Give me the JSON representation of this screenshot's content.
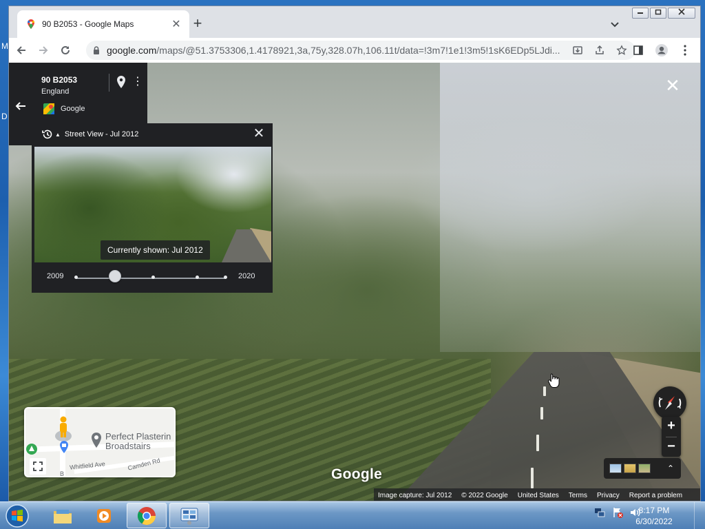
{
  "desktop": {
    "letters": [
      "M",
      "D"
    ]
  },
  "browser": {
    "tab_title": "90 B2053 - Google Maps",
    "tab_close": "✕",
    "new_tab": "+",
    "url_host": "google.com",
    "url_rest": "/maps/@51.3753306,1.4178921,3a,75y,328.07h,106.11t/data=!3m7!1e1!3m5!1sK6EDp5LJdi..."
  },
  "address_card": {
    "title": "90 B2053",
    "subtitle": "England",
    "source": "Google",
    "more": "⋮"
  },
  "time_machine": {
    "title": "Street View - Jul 2012",
    "currently_shown": "Currently shown: Jul 2012",
    "year_start": "2009",
    "year_end": "2020",
    "caret": "▲",
    "close": "✕",
    "slider_fraction": 0.26
  },
  "minimap": {
    "place_line1": "Perfect Plasterin",
    "place_line2": "Broadstairs",
    "street1": "Whitfield Ave",
    "street2": "Camden Rd",
    "street3": "B"
  },
  "viewer": {
    "logo": "Google",
    "close": "✕",
    "zoom_in": "+",
    "zoom_out": "−",
    "layers_expand": "⌃"
  },
  "attribution": {
    "capture": "Image capture: Jul 2012",
    "copyright": "© 2022 Google",
    "region": "United States",
    "terms": "Terms",
    "privacy": "Privacy",
    "report": "Report a problem"
  },
  "taskbar": {
    "time": "8:17 PM",
    "date": "6/30/2022"
  },
  "colors": {
    "panel_bg": "#202124",
    "chrome_bg": "#dee1e6",
    "taskbar": "#4e7fb6"
  }
}
